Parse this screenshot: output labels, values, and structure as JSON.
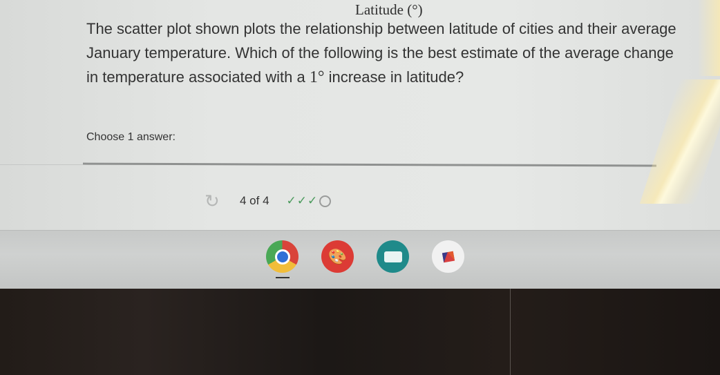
{
  "chart_header": {
    "axis_label": "Latitude (°)"
  },
  "question": {
    "text_before_deg": "The scatter plot shown plots the relationship between latitude of cities and their average January temperature. Which of the following is the best estimate of the average change in temperature associated with a ",
    "degree": "1°",
    "text_after_deg": " increase in latitude?"
  },
  "answer_prompt": "Choose 1 answer:",
  "progress": {
    "reload_icon": "↻",
    "count_text": "4 of 4",
    "marks": [
      "correct",
      "correct",
      "correct",
      "pending"
    ],
    "check_glyph": "✓",
    "check_color": "#4a9a5c"
  },
  "shelf": {
    "apps": [
      {
        "name": "Chrome",
        "icon": "chrome-icon",
        "active": true
      },
      {
        "name": "Paint",
        "icon": "palette-icon",
        "active": false
      },
      {
        "name": "Slides",
        "icon": "slides-icon",
        "active": false
      },
      {
        "name": "Kite",
        "icon": "kite-icon",
        "active": false
      }
    ]
  }
}
